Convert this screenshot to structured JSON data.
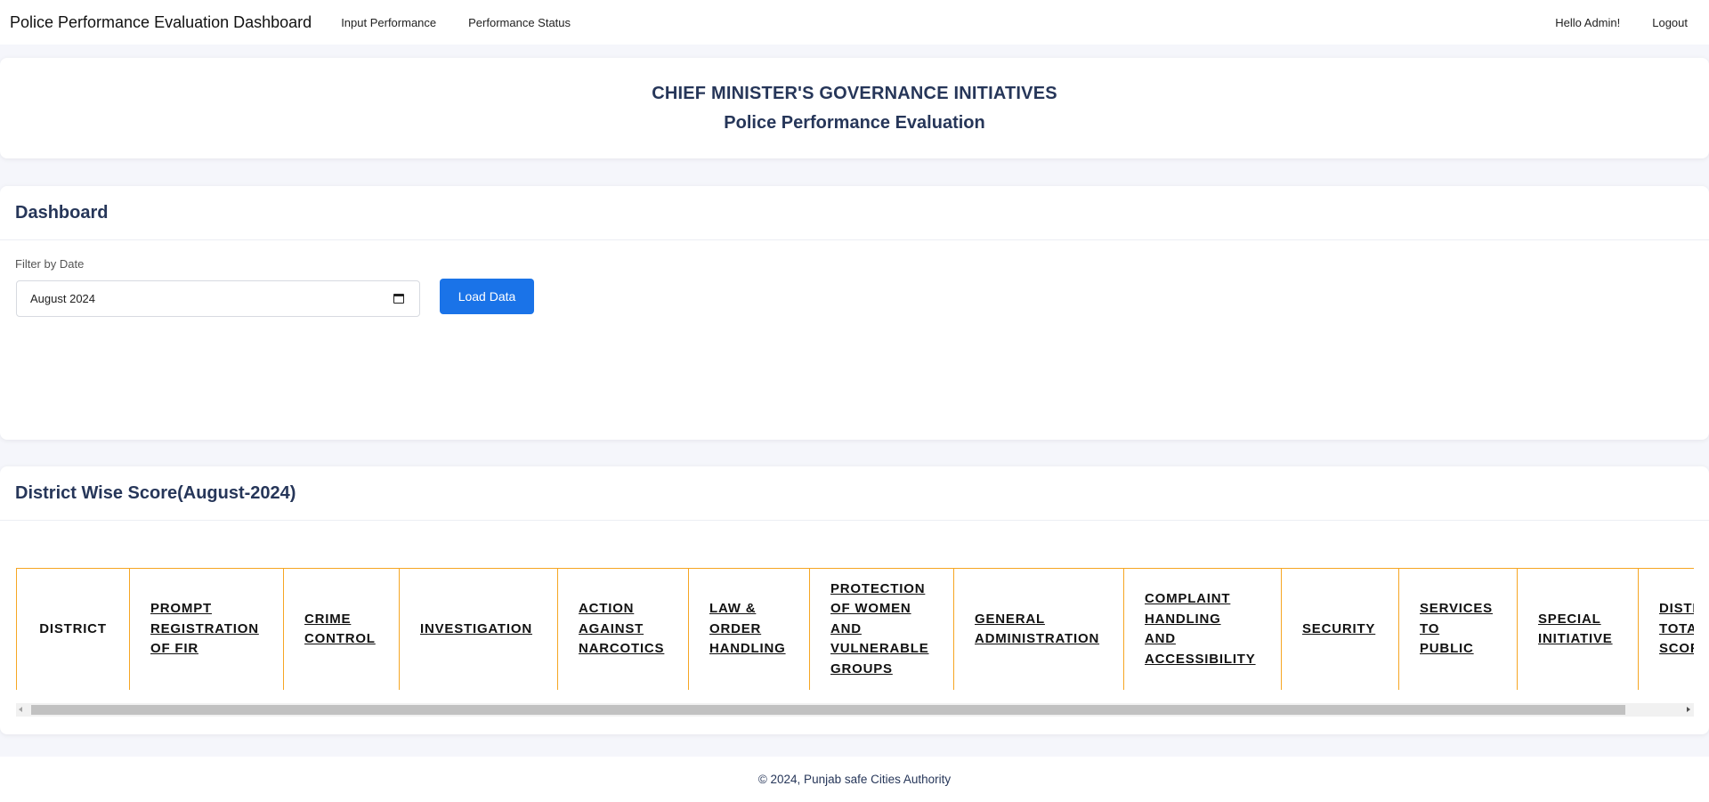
{
  "navbar": {
    "brand": "Police Performance Evaluation Dashboard",
    "links": [
      "Input Performance",
      "Performance Status"
    ],
    "greeting": "Hello Admin!",
    "logout": "Logout"
  },
  "hero": {
    "title": "CHIEF MINISTER'S GOVERNANCE INITIATIVES",
    "subtitle": "Police Performance Evaluation"
  },
  "dashboard": {
    "title": "Dashboard",
    "filter_label": "Filter by Date",
    "date_value": "August 2024",
    "load_button": "Load Data"
  },
  "score": {
    "title": "District Wise Score(August-2024)",
    "columns": [
      {
        "label": "DISTRICT",
        "lines": [
          "DISTRICT"
        ]
      },
      {
        "label": "PROMPT REGISTRATION OF FIR",
        "lines": [
          "PROMPT",
          "REGISTRATION",
          "OF FIR"
        ]
      },
      {
        "label": "CRIME CONTROL",
        "lines": [
          "CRIME",
          "CONTROL"
        ]
      },
      {
        "label": "INVESTIGATION",
        "lines": [
          "INVESTIGATION"
        ]
      },
      {
        "label": "ACTION AGAINST NARCOTICS",
        "lines": [
          "ACTION",
          "AGAINST",
          "NARCOTICS"
        ]
      },
      {
        "label": "LAW & ORDER HANDLING",
        "lines": [
          "LAW &",
          "ORDER",
          "HANDLING"
        ]
      },
      {
        "label": "PROTECTION OF WOMEN AND VULNERABLE GROUPS",
        "lines": [
          "PROTECTION",
          "OF WOMEN",
          "AND",
          "VULNERABLE",
          "GROUPS"
        ]
      },
      {
        "label": "GENERAL ADMINISTRATION",
        "lines": [
          "GENERAL",
          "ADMINISTRATION"
        ]
      },
      {
        "label": "COMPLAINT HANDLING AND ACCESSIBILITY",
        "lines": [
          "COMPLAINT",
          "HANDLING",
          "AND",
          "ACCESSIBILITY"
        ]
      },
      {
        "label": "SECURITY",
        "lines": [
          "SECURITY"
        ]
      },
      {
        "label": "SERVICES TO PUBLIC",
        "lines": [
          "SERVICES",
          "TO",
          "PUBLIC"
        ]
      },
      {
        "label": "SPECIAL INITIATIVE",
        "lines": [
          "SPECIAL",
          "INITIATIVE"
        ]
      },
      {
        "label": "DISTRICT TOTAL SCORE",
        "lines": [
          "DISTRICT",
          "TOTAL",
          "SCORE"
        ]
      }
    ]
  },
  "footer": {
    "text": "© 2024, Punjab safe Cities Authority"
  },
  "colors": {
    "accent": "#1a73e8",
    "heading": "#263659",
    "table_border": "#f6a623"
  }
}
